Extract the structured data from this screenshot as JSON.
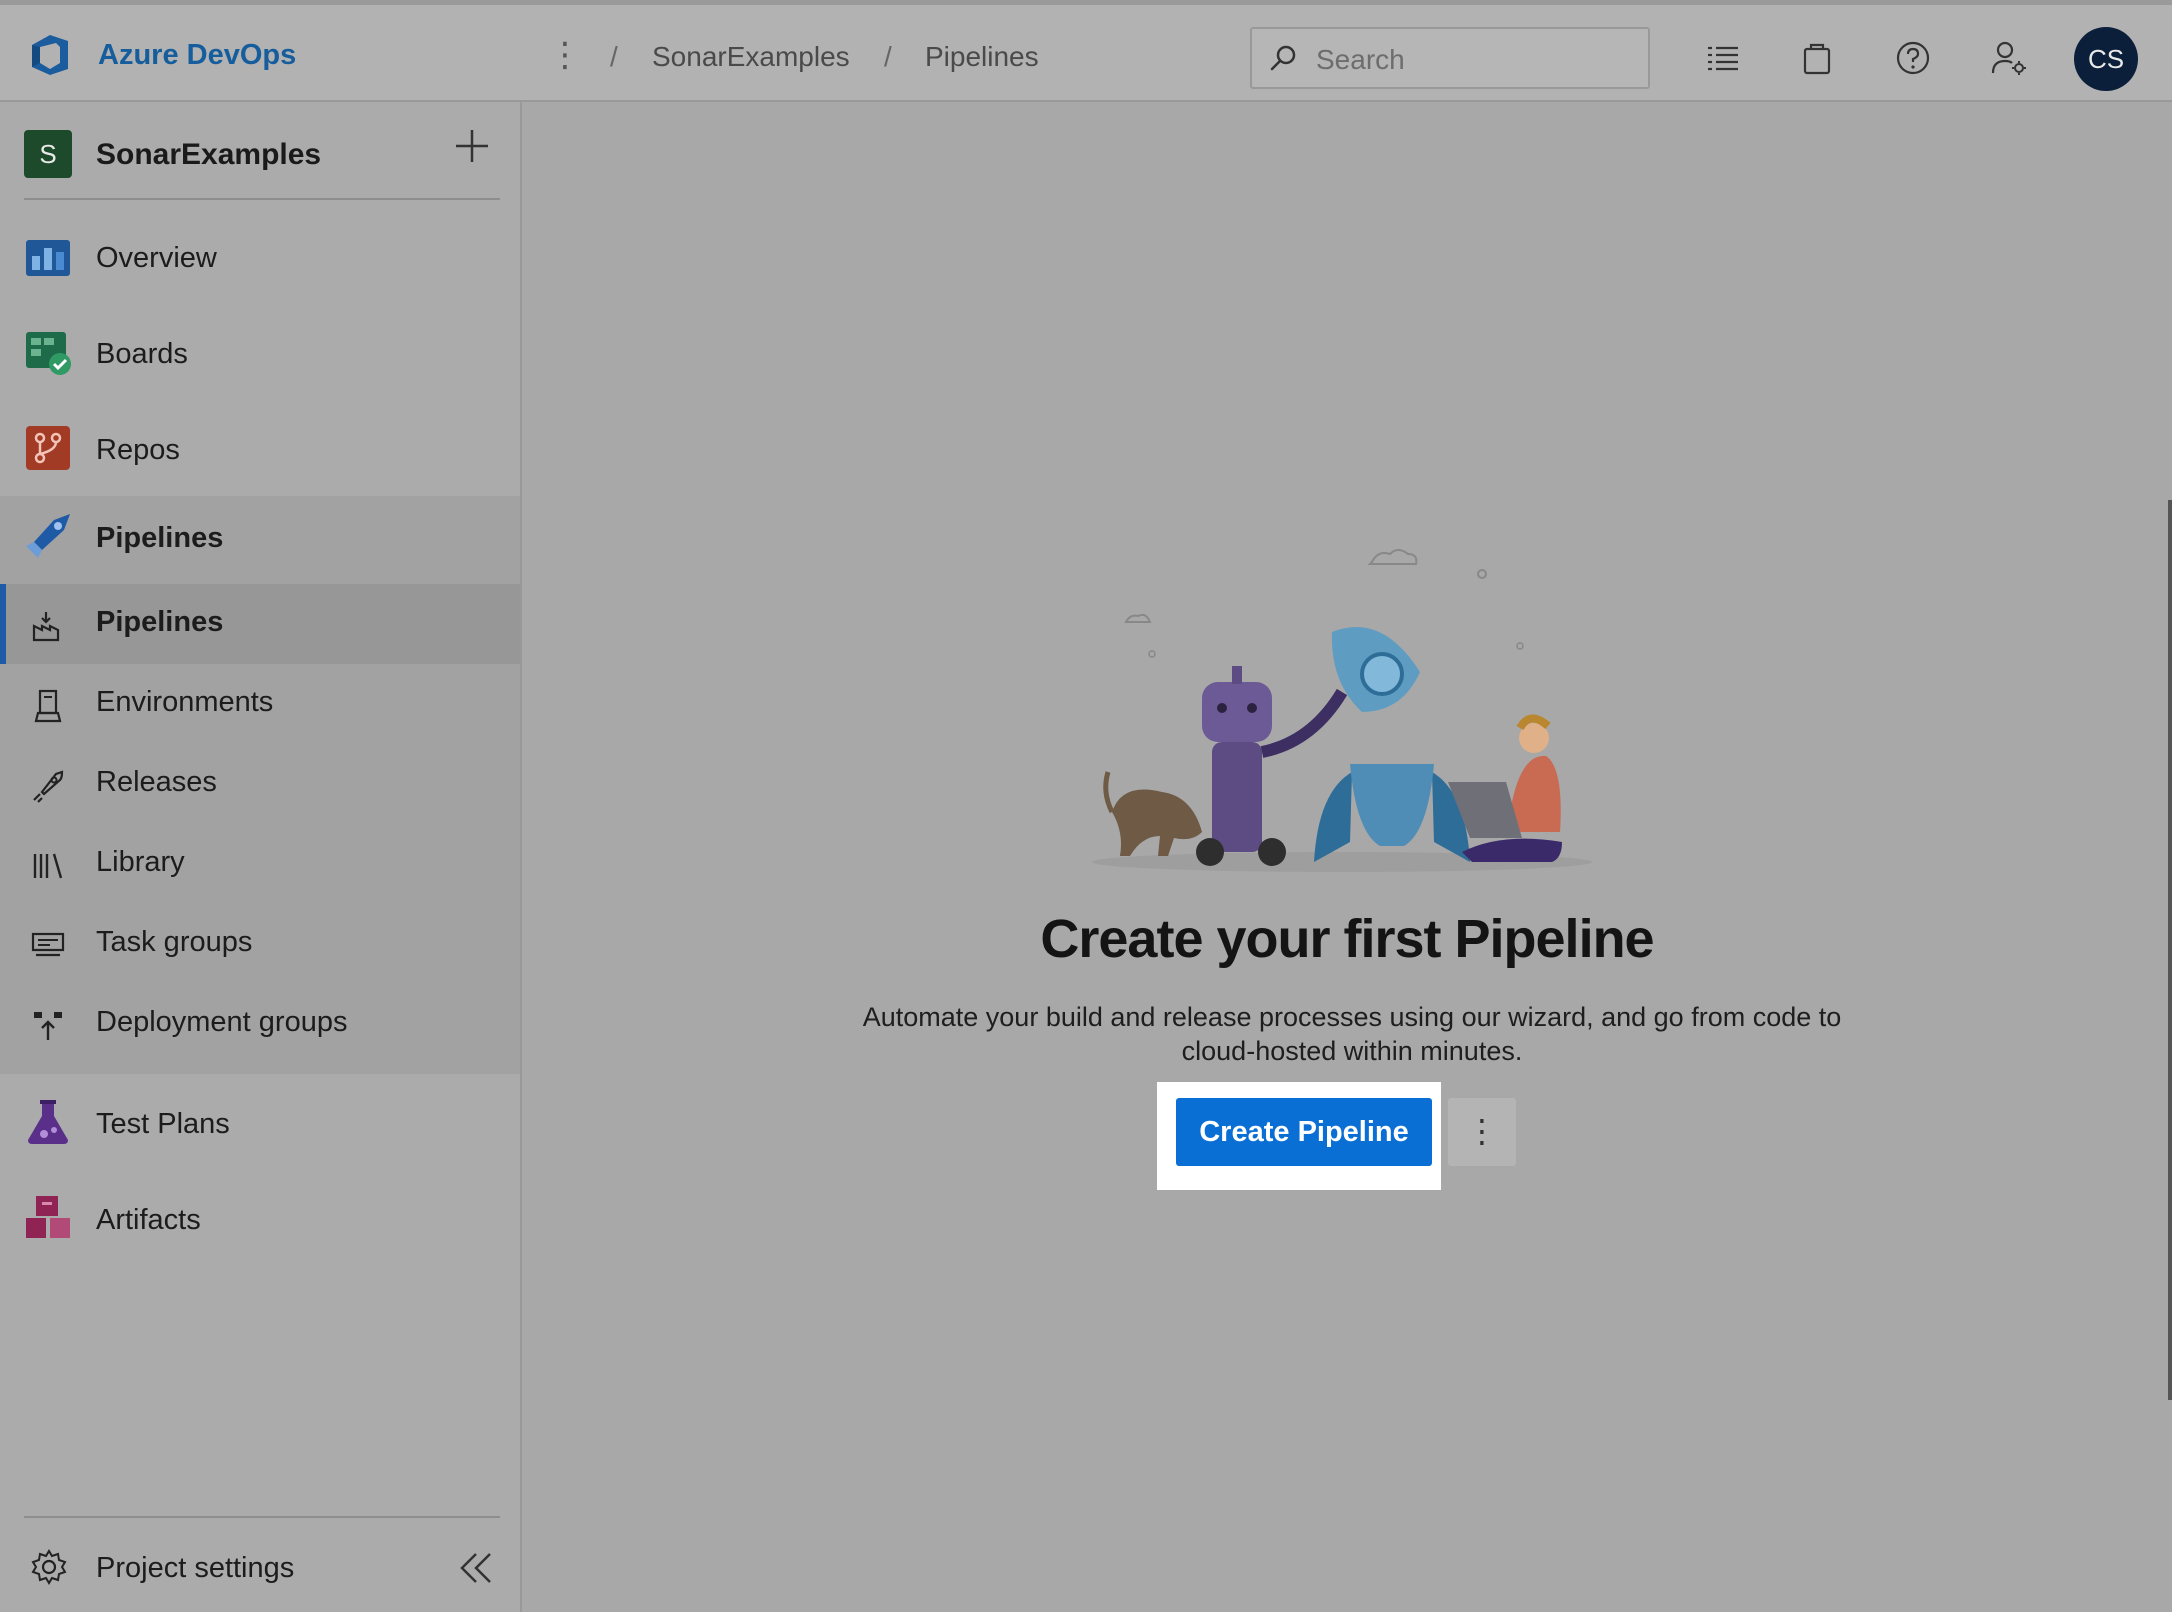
{
  "header": {
    "brand": "Azure DevOps",
    "breadcrumb": [
      "SonarExamples",
      "Pipelines"
    ],
    "search_placeholder": "Search",
    "avatar_initials": "CS"
  },
  "sidebar": {
    "project_initial": "S",
    "project_name": "SonarExamples",
    "items": [
      {
        "label": "Overview"
      },
      {
        "label": "Boards"
      },
      {
        "label": "Repos"
      },
      {
        "label": "Pipelines"
      }
    ],
    "pipeline_subitems": [
      {
        "label": "Pipelines"
      },
      {
        "label": "Environments"
      },
      {
        "label": "Releases"
      },
      {
        "label": "Library"
      },
      {
        "label": "Task groups"
      },
      {
        "label": "Deployment groups"
      }
    ],
    "bottom_items": [
      {
        "label": "Test Plans"
      },
      {
        "label": "Artifacts"
      }
    ],
    "settings_label": "Project settings"
  },
  "main": {
    "title": "Create your first Pipeline",
    "description": "Automate your build and release processes using our wizard, and go from code to cloud-hosted within minutes.",
    "create_button": "Create Pipeline",
    "more_button": "⋮"
  },
  "colors": {
    "accent": "#0a6fd4",
    "brand": "#155d9c",
    "selection_bar": "#1e5aa8"
  }
}
